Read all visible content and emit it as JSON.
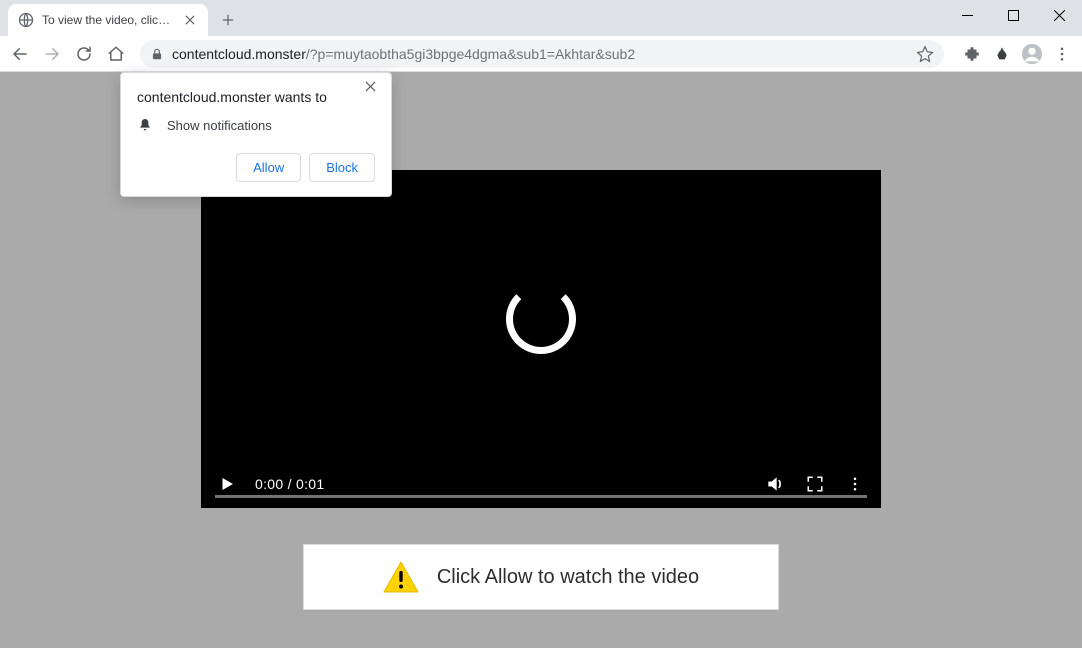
{
  "tab": {
    "title": "To view the video, click the Allow"
  },
  "url": {
    "host": "contentcloud.monster",
    "path": "/?p=muytaobtha5gi3bpge4dgma&sub1=Akhtar&sub2"
  },
  "notification": {
    "origin": "contentcloud.monster wants to",
    "permission": "Show notifications",
    "allow": "Allow",
    "block": "Block"
  },
  "video": {
    "time": "0:00 / 0:01"
  },
  "banner": {
    "text": "Click Allow to watch the video"
  }
}
